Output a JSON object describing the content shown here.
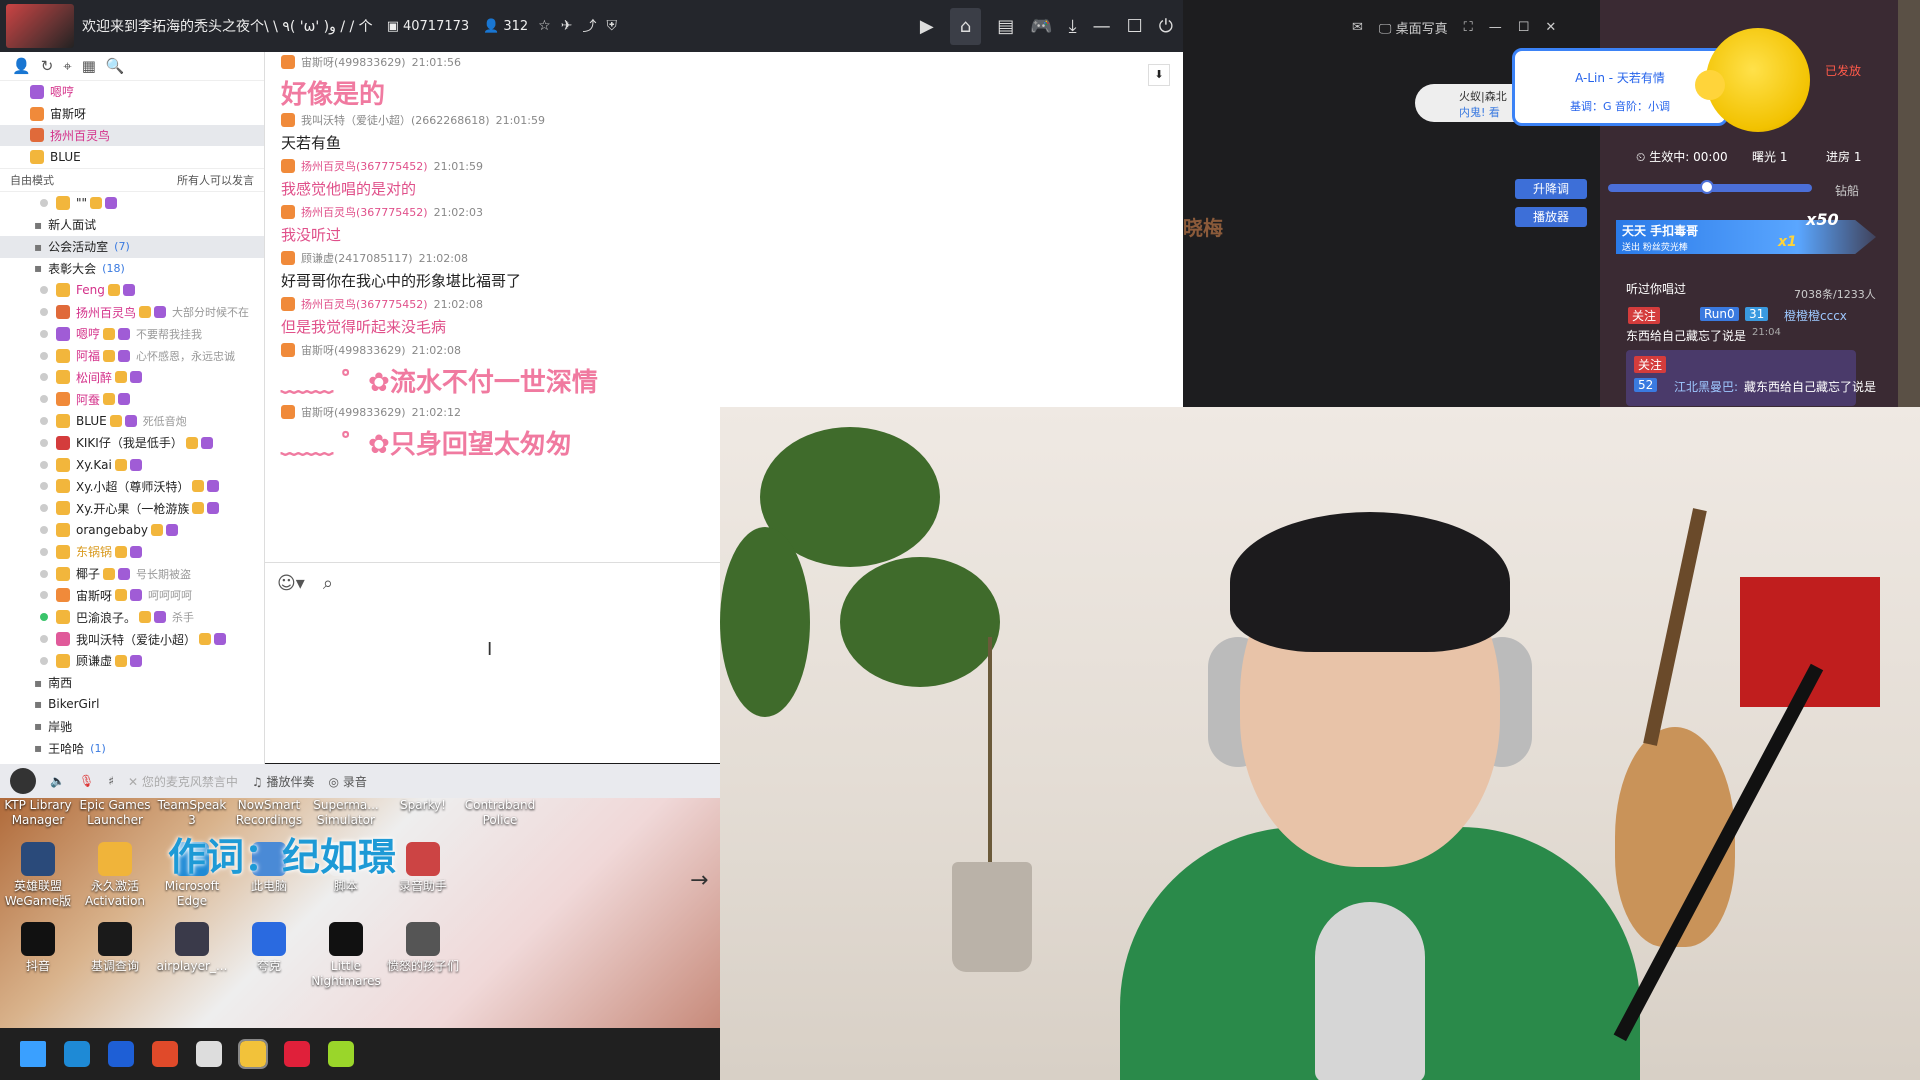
{
  "titlebar": {
    "title": "欢迎来到李拓海的秃头之夜个\\ \\ ٩( 'ω' )و / / 个",
    "channel_id": "40717173",
    "online_count": "312"
  },
  "left_panel": {
    "top_members": [
      {
        "name": "嗯哼",
        "color": "#d4318a",
        "badge": "#a05cd6"
      },
      {
        "name": "宙斯呀",
        "color": "#222",
        "badge": "#f08a3a"
      },
      {
        "name": "扬州百灵鸟",
        "color": "#d4318a",
        "badge": "#e06a3a"
      },
      {
        "name": "BLUE",
        "color": "#222",
        "badge": "#f2b63c"
      }
    ],
    "mode_label": "自由模式",
    "mode_permission": "所有人可以发言",
    "tree": [
      {
        "name": "\"\"",
        "color": "#222",
        "badge": "#f2b63c",
        "sig": ""
      },
      {
        "name": "新人面试",
        "color": "#222",
        "badge": "",
        "sig": ""
      },
      {
        "name": "公会活动室",
        "color": "#222",
        "badge": "",
        "sig": "(7)"
      },
      {
        "name": "表彰大会",
        "color": "#222",
        "badge": "",
        "sig": "(18)"
      },
      {
        "name": "Feng",
        "color": "#d4318a",
        "badge": "#f2b63c",
        "sig": ""
      },
      {
        "name": "扬州百灵鸟",
        "color": "#d4318a",
        "badge": "#e06a3a",
        "sig": "大部分时候不在"
      },
      {
        "name": "嗯哼",
        "color": "#d4318a",
        "badge": "#a05cd6",
        "sig": "不要帮我挂我"
      },
      {
        "name": "阿福",
        "color": "#d4318a",
        "badge": "#f2b63c",
        "sig": "心怀感恩，永远忠诚"
      },
      {
        "name": "松间醉",
        "color": "#d4318a",
        "badge": "#f2b63c",
        "sig": ""
      },
      {
        "name": "阿蚕",
        "color": "#d4318a",
        "badge": "#f08a3a",
        "sig": ""
      },
      {
        "name": "BLUE",
        "color": "#222",
        "badge": "#f2b63c",
        "sig": "死低音炮"
      },
      {
        "name": "KIKI仔（我是低手）",
        "color": "#222",
        "badge": "#d43c3c",
        "sig": ""
      },
      {
        "name": "Xy.Kai",
        "color": "#222",
        "badge": "#f2b63c",
        "sig": ""
      },
      {
        "name": "Xy.小超（尊师沃特）",
        "color": "#222",
        "badge": "#f2b63c",
        "sig": ""
      },
      {
        "name": "Xy.开心果（一枪游族",
        "color": "#222",
        "badge": "#f2b63c",
        "sig": ""
      },
      {
        "name": "orangebaby",
        "color": "#222",
        "badge": "#f2b63c",
        "sig": ""
      },
      {
        "name": "东锅锅",
        "color": "#d99a1e",
        "badge": "#f2b63c",
        "sig": ""
      },
      {
        "name": "椰子",
        "color": "#222",
        "badge": "#f2b63c",
        "sig": "号长期被盗"
      },
      {
        "name": "宙斯呀",
        "color": "#222",
        "badge": "#f08a3a",
        "sig": "呵呵呵呵"
      },
      {
        "name": "巴渝浪子。",
        "color": "#222",
        "badge": "#f2b63c",
        "sig": "杀手"
      },
      {
        "name": "我叫沃特（爱徒小超）",
        "color": "#222",
        "badge": "#e05a9a",
        "sig": ""
      },
      {
        "name": "顾谦虚",
        "color": "#222",
        "badge": "#f2b63c",
        "sig": ""
      },
      {
        "name": "南西",
        "color": "#222",
        "badge": "",
        "sig": ""
      },
      {
        "name": "BikerGirl",
        "color": "#222",
        "badge": "",
        "sig": ""
      },
      {
        "name": "岸驰",
        "color": "#222",
        "badge": "",
        "sig": ""
      },
      {
        "name": "王哈哈",
        "color": "#222",
        "badge": "",
        "sig": "(1)"
      }
    ]
  },
  "chat": {
    "messages": [
      {
        "meta": "宙斯呀(499833629)",
        "time": "21:01:56",
        "text": "好像是的",
        "style": "big-pink"
      },
      {
        "meta": "我叫沃特（爱徒小超）(2662268618)",
        "time": "21:01:59",
        "text": "天若有鱼",
        "style": "normal"
      },
      {
        "meta": "扬州百灵鸟(367775452)",
        "time": "21:01:59",
        "text": "我感觉他唱的是对的",
        "style": "pink"
      },
      {
        "meta": "扬州百灵鸟(367775452)",
        "time": "21:02:03",
        "text": "我没听过",
        "style": "pink"
      },
      {
        "meta": "顾谦虚(2417085117)",
        "time": "21:02:08",
        "text": "好哥哥你在我心中的形象堪比福哥了",
        "style": "normal"
      },
      {
        "meta": "扬州百灵鸟(367775452)",
        "time": "21:02:08",
        "text": "但是我觉得听起来没毛病",
        "style": "pink"
      },
      {
        "meta": "宙斯呀(499833629)",
        "time": "21:02:08",
        "text": "﹏﹏ ゜✿流水不付一世深情",
        "style": "big-pink"
      },
      {
        "meta": "宙斯呀(499833629)",
        "time": "21:02:12",
        "text": "﹏﹏ ゜✿只身回望太匆匆",
        "style": "big-pink"
      }
    ]
  },
  "audiobar": {
    "status": "您的麦克风禁言中",
    "accompany": "播放伴奏",
    "record": "录音"
  },
  "desktop": {
    "row0": [
      "KTP Library Manager",
      "Epic Games Launcher",
      "TeamSpeak 3",
      "NowSmart Recordings",
      "Superma... Simulator",
      "Sparky!",
      "Contraband Police"
    ],
    "row1": [
      {
        "label": "英雄联盟WeGame版",
        "color": "#2a4a7a"
      },
      {
        "label": "永久激活Activation",
        "color": "#f0b43a"
      },
      {
        "label": "Microsoft Edge",
        "color": "#1e8ad6"
      },
      {
        "label": "此电脑",
        "color": "#4a8ad6"
      },
      {
        "label": "脚本",
        "color": "#eeeeee"
      },
      {
        "label": "录音助手",
        "color": "#cc4444"
      }
    ],
    "row2": [
      {
        "label": "抖音",
        "color": "#111111"
      },
      {
        "label": "基调查询",
        "color": "#1a1a1a"
      },
      {
        "label": "airplayer_...",
        "color": "#3a3a4a"
      },
      {
        "label": "夸克",
        "color": "#2a6ae0"
      },
      {
        "label": "Little Nightmares",
        "color": "#111111"
      },
      {
        "label": "愤怒的孩子们",
        "color": "#555555"
      }
    ],
    "lyric": "作词：纪如璟"
  },
  "taskbar": {
    "icons": [
      "#3aa0ff",
      "#1e8ad6",
      "#1e5fd6",
      "#e04a2a",
      "#dddddd",
      "#f2c23a",
      "#e0203a",
      "#9ad62a"
    ]
  },
  "stream": {
    "window_label": "桌面写真",
    "pill_name": "火蚁|森北",
    "pill_sub": "内鬼! 看",
    "faded_name": "晓梅",
    "btn_raise": "升降调",
    "btn_player": "播放器",
    "song_title": "A-Lin - 天若有情",
    "song_key": "基调：G  音阶：小调",
    "sent_label": "已发放",
    "effect_label": "生效中:",
    "effect_time": "00:00",
    "shuguang": "曙光 1",
    "jinfang": "进房 1",
    "drill": "钻船",
    "banner_title": "天天 手扣毒哥",
    "banner_sub": "送出  粉丝荧光棒",
    "mult_1": "x50",
    "mult_2": "x1",
    "heard": "听过你唱过",
    "stats": "7038条/1233人",
    "follow": "关注",
    "user_run": "Run0",
    "user_lv": "31",
    "user_name": "橙橙橙cccx",
    "comment1": "东西给自己藏忘了说是",
    "comment1_time": "21:04",
    "user2_lv": "52",
    "user2_name": "江北黑曼巴:",
    "comment2": "藏东西给自己藏忘了说是"
  }
}
